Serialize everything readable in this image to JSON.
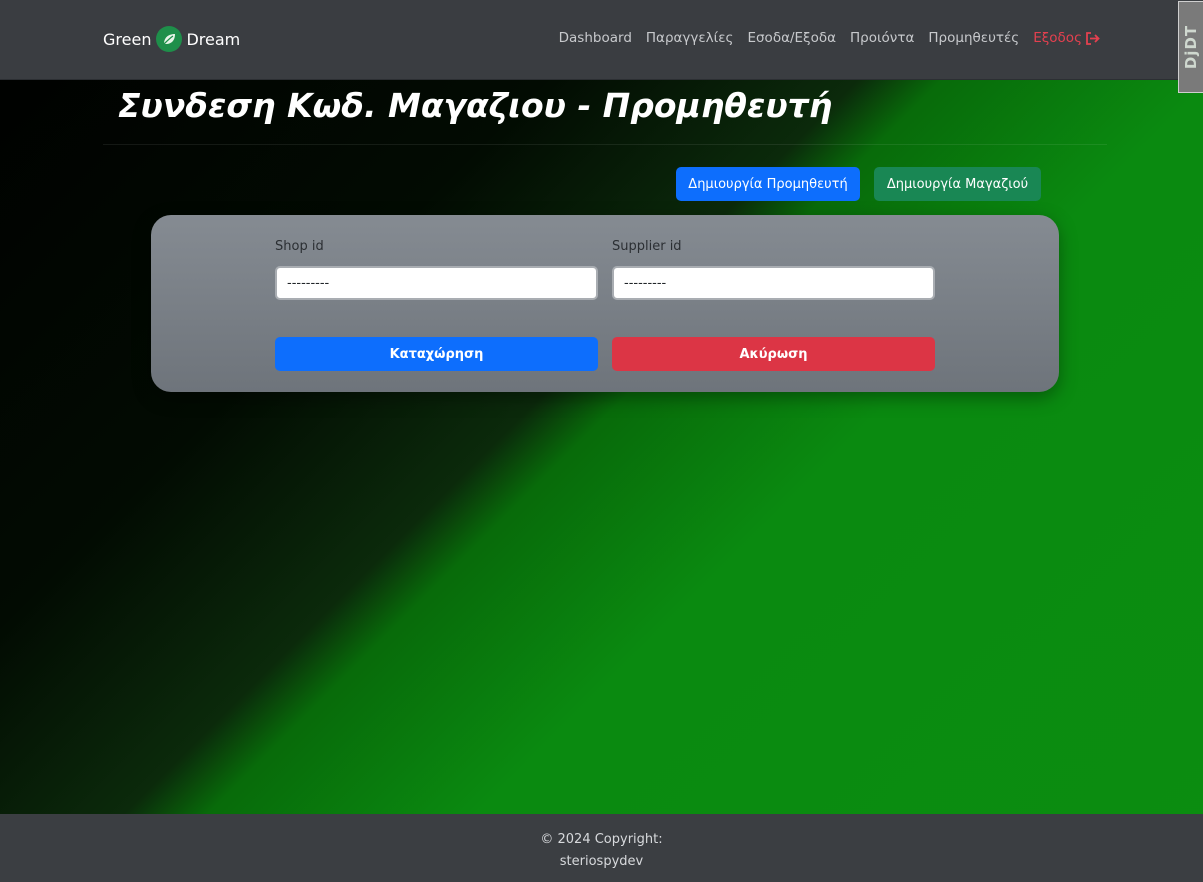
{
  "nav": {
    "brand_left": "Green",
    "brand_right": "Dream",
    "links": [
      "Dashboard",
      "Παραγγελίες",
      "Εσοδα/Εξοδα",
      "Προιόντα",
      "Προμηθευτές"
    ],
    "logout": "Εξοδος"
  },
  "toolbar": {
    "label": "DjDT"
  },
  "page": {
    "title": "Συνδεση Κωδ. Μαγαζιου - Προμηθευτή"
  },
  "actions": {
    "create_supplier": "Δημιουργία Προμηθευτή",
    "create_shop": "Δημιουργία Μαγαζιού"
  },
  "form": {
    "shop_label": "Shop id",
    "shop_value": "---------",
    "supplier_label": "Supplier id",
    "supplier_value": "---------",
    "submit": "Καταχώρηση",
    "cancel": "Ακύρωση"
  },
  "footer": {
    "line1": "© 2024 Copyright:",
    "line2": "steriospydev"
  },
  "colors": {
    "primary": "#0d6efd",
    "success": "#198754",
    "danger": "#dc3545",
    "navbar": "#3a3d41"
  }
}
